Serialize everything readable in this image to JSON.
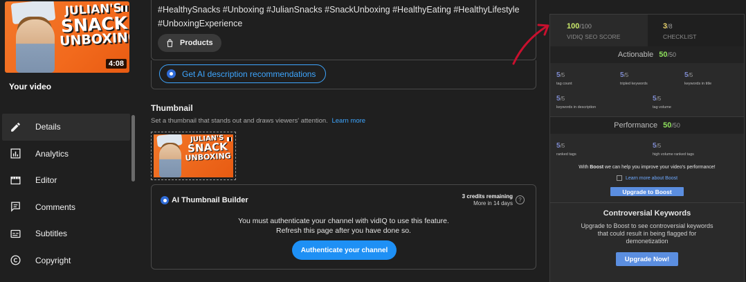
{
  "video": {
    "thumb_title_line1": "JULIAN'S",
    "thumb_title_line2": "SNACK",
    "thumb_title_line3": "UNBOXING",
    "duration": "4:08",
    "your_video_label": "Your video"
  },
  "sidebar": {
    "items": [
      {
        "label": "Details",
        "icon": "pencil-icon",
        "active": true
      },
      {
        "label": "Analytics",
        "icon": "analytics-icon",
        "active": false
      },
      {
        "label": "Editor",
        "icon": "editor-icon",
        "active": false
      },
      {
        "label": "Comments",
        "icon": "comments-icon",
        "active": false
      },
      {
        "label": "Subtitles",
        "icon": "subtitles-icon",
        "active": false
      },
      {
        "label": "Copyright",
        "icon": "copyright-icon",
        "active": false
      }
    ]
  },
  "description": {
    "hashtags_line1": "#HealthySnacks #Unboxing #JulianSnacks #SnackUnboxing #HealthyEating #HealthyLifestyle",
    "hashtags_line2": "#UnboxingExperience",
    "products_label": "Products",
    "ai_button_label": "Get AI description recommendations"
  },
  "thumbnail": {
    "heading": "Thumbnail",
    "subtitle": "Set a thumbnail that stands out and draws viewers' attention.",
    "learn_more": "Learn more"
  },
  "ai_builder": {
    "title": "AI Thumbnail Builder",
    "credits_line1": "3 credits remaining",
    "credits_line2": "More in 14 days",
    "help": "?",
    "message_line1": "You must authenticate your channel with vidIQ to use this feature.",
    "message_line2": "Refresh this page after you have done so.",
    "auth_button": "Authenticate your channel"
  },
  "vidiq": {
    "tabs": [
      {
        "value": "100",
        "max": "/100",
        "label": "VIDIQ SEO SCORE"
      },
      {
        "value": "3",
        "max": "/8",
        "label": "CHECKLIST"
      }
    ],
    "actionable": {
      "label": "Actionable",
      "score": "50",
      "max": "/50",
      "metrics": [
        {
          "value": "5",
          "max": "/5",
          "label": "tag count"
        },
        {
          "value": "5",
          "max": "/5",
          "label": "tripled keywords"
        },
        {
          "value": "5",
          "max": "/5",
          "label": "keywords in title"
        },
        {
          "value": "5",
          "max": "/5",
          "label": "keywords in description"
        },
        {
          "value": "5",
          "max": "/5",
          "label": "tag volume"
        }
      ]
    },
    "performance": {
      "label": "Performance",
      "score": "50",
      "max": "/50",
      "metrics": [
        {
          "value": "5",
          "max": "/5",
          "label": "ranked tags"
        },
        {
          "value": "5",
          "max": "/5",
          "label": "high volume ranked tags"
        }
      ],
      "boost_info_prefix": "With ",
      "boost_info_bold": "Boost",
      "boost_info_suffix": " we can help you improve your video's performance!",
      "learn_boost": "Learn more about Boost",
      "boost_button": "Upgrade to Boost"
    },
    "controversial": {
      "title": "Controversial Keywords",
      "desc": "Upgrade to Boost to see controversial keywords that could result in being flagged for demonetization",
      "button": "Upgrade Now!"
    }
  },
  "colors": {
    "accent_blue": "#3ea6ff",
    "score_green": "#8ee05c",
    "arrow_red": "#c8102e"
  }
}
